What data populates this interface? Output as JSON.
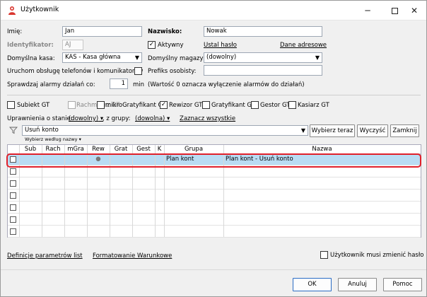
{
  "window": {
    "title": "Użytkownik",
    "controls": {
      "minimize": "─",
      "maximize": "",
      "close": "✕"
    }
  },
  "form": {
    "imie_label": "Imię:",
    "imie_value": "Jan",
    "nazwisko_label": "Nazwisko:",
    "nazwisko_value": "Nowak",
    "identyfikator_label": "Identyfikator:",
    "identyfikator_value": "AJ",
    "aktywny_label": "Aktywny",
    "aktywny_checked": "✓",
    "ustal_haslo": "Ustal hasło",
    "dane_adresowe": "Dane adresowe",
    "domyslna_kasa_label": "Domyślna kasa:",
    "domyslna_kasa_value": "KAS - Kasa główna",
    "domyslny_magazyn_label": "Domyślny magazyn:",
    "domyslny_magazyn_value": "(dowolny)",
    "uruchom_label": "Uruchom obsługę telefonów i komunikatorów",
    "prefiks_label": "Prefiks osobisty:",
    "prefiks_value": "",
    "sprawdzaj_label": "Sprawdzaj alarmy działań co:",
    "sprawdzaj_value": "1",
    "min_label": "min",
    "sprawdzaj_note": "(Wartość 0 oznacza wyłączenie alarmów do działań)"
  },
  "modules": [
    {
      "label": "Subiekt GT",
      "checked": "",
      "disabled": false
    },
    {
      "label": "Rachmistrz GT",
      "checked": "",
      "disabled": true
    },
    {
      "label": "mikroGratyfikant GT",
      "checked": "",
      "disabled": false
    },
    {
      "label": "Rewizor GT",
      "checked": "✓",
      "disabled": false
    },
    {
      "label": "Gratyfikant GT",
      "checked": "",
      "disabled": false
    },
    {
      "label": "Gestor GT",
      "checked": "",
      "disabled": false
    },
    {
      "label": "Kasiarz GT",
      "checked": "",
      "disabled": false
    }
  ],
  "permissions": {
    "uprawnienia_label": "Uprawnienia o stanie:",
    "stan_value": "(dowolny)",
    "z_grupy_label": ", z grupy:",
    "grupa_value": "(dowolna)",
    "zaznacz_wszystkie": "Zaznacz wszystkie",
    "search_value": "Usuń konto",
    "search_hint": "Wybierz według nazwy",
    "wybierz_teraz": "Wybierz teraz",
    "wyczysc": "Wyczyść",
    "zamknij": "Zamknij"
  },
  "table": {
    "columns": [
      "Sub",
      "Rach",
      "mGra",
      "Rew",
      "Grat",
      "Gest",
      "K",
      "Grupa",
      "Nazwa"
    ],
    "rows": [
      {
        "sub": "",
        "rach": "",
        "mgra": "",
        "rew": "●",
        "grat": "",
        "gest": "",
        "k": "",
        "grupa": "Plan kont",
        "nazwa": "Plan kont - Usuń konto"
      },
      {
        "sub": "",
        "rach": "",
        "mgra": "",
        "rew": "",
        "grat": "",
        "gest": "",
        "k": "",
        "grupa": "",
        "nazwa": ""
      },
      {
        "sub": "",
        "rach": "",
        "mgra": "",
        "rew": "",
        "grat": "",
        "gest": "",
        "k": "",
        "grupa": "",
        "nazwa": ""
      },
      {
        "sub": "",
        "rach": "",
        "mgra": "",
        "rew": "",
        "grat": "",
        "gest": "",
        "k": "",
        "grupa": "",
        "nazwa": ""
      },
      {
        "sub": "",
        "rach": "",
        "mgra": "",
        "rew": "",
        "grat": "",
        "gest": "",
        "k": "",
        "grupa": "",
        "nazwa": ""
      },
      {
        "sub": "",
        "rach": "",
        "mgra": "",
        "rew": "",
        "grat": "",
        "gest": "",
        "k": "",
        "grupa": "",
        "nazwa": ""
      },
      {
        "sub": "",
        "rach": "",
        "mgra": "",
        "rew": "",
        "grat": "",
        "gest": "",
        "k": "",
        "grupa": "",
        "nazwa": ""
      }
    ]
  },
  "links": {
    "definicje": "Definicje parametrów list",
    "formatowanie": "Formatowanie Warunkowe",
    "musi_zmienic_label": "Użytkownik musi zmienić hasło"
  },
  "footer": {
    "ok": "OK",
    "anuluj": "Anuluj",
    "pomoc": "Pomoc"
  },
  "colors": {
    "selection": "#b9dcf3",
    "highlight_border": "#e0202a",
    "accent": "#2b6cc4"
  }
}
